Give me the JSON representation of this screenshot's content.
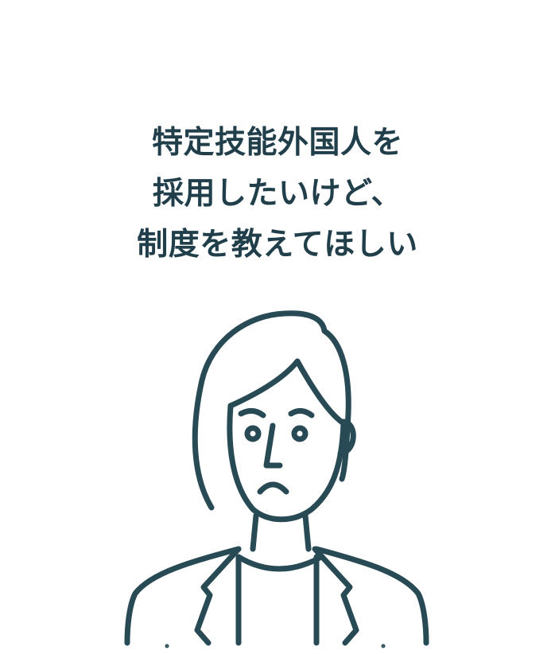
{
  "headline": {
    "lines": [
      "特定技能外国人を",
      "採用したいけど、",
      "制度を教えてほしい"
    ]
  },
  "illustration": {
    "subject": "worried-person-icon",
    "stroke_color": "#284a55"
  }
}
